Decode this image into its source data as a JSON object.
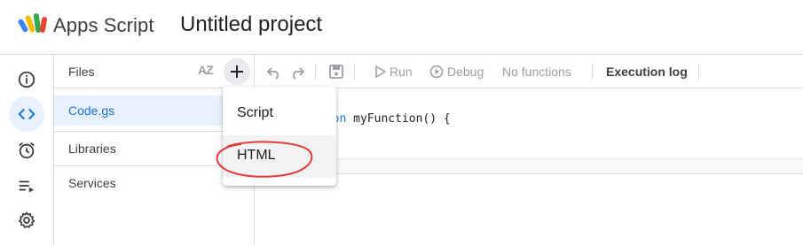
{
  "header": {
    "app_name": "Apps Script",
    "project_title": "Untitled project"
  },
  "rail": {
    "items": [
      {
        "icon": "info-icon",
        "active": false
      },
      {
        "icon": "code-icon",
        "active": true
      },
      {
        "icon": "alarm-icon",
        "active": false
      },
      {
        "icon": "executions-icon",
        "active": false
      },
      {
        "icon": "gear-icon",
        "active": false
      }
    ]
  },
  "files": {
    "title": "Files",
    "sort_icon": "AZ",
    "items": [
      {
        "name": "Code.gs",
        "selected": true
      }
    ],
    "sections": [
      "Libraries",
      "Services"
    ]
  },
  "toolbar": {
    "run_label": "Run",
    "debug_label": "Debug",
    "functions_label": "No functions",
    "log_label": "Execution log"
  },
  "editor": {
    "code_keyword": "tion",
    "code_rest": " myFunction() {"
  },
  "menu": {
    "items": [
      "Script",
      "HTML"
    ]
  },
  "colors": {
    "accent": "#1a73e8",
    "annotation": "#e53935",
    "active_bg": "#e8f0fe"
  }
}
